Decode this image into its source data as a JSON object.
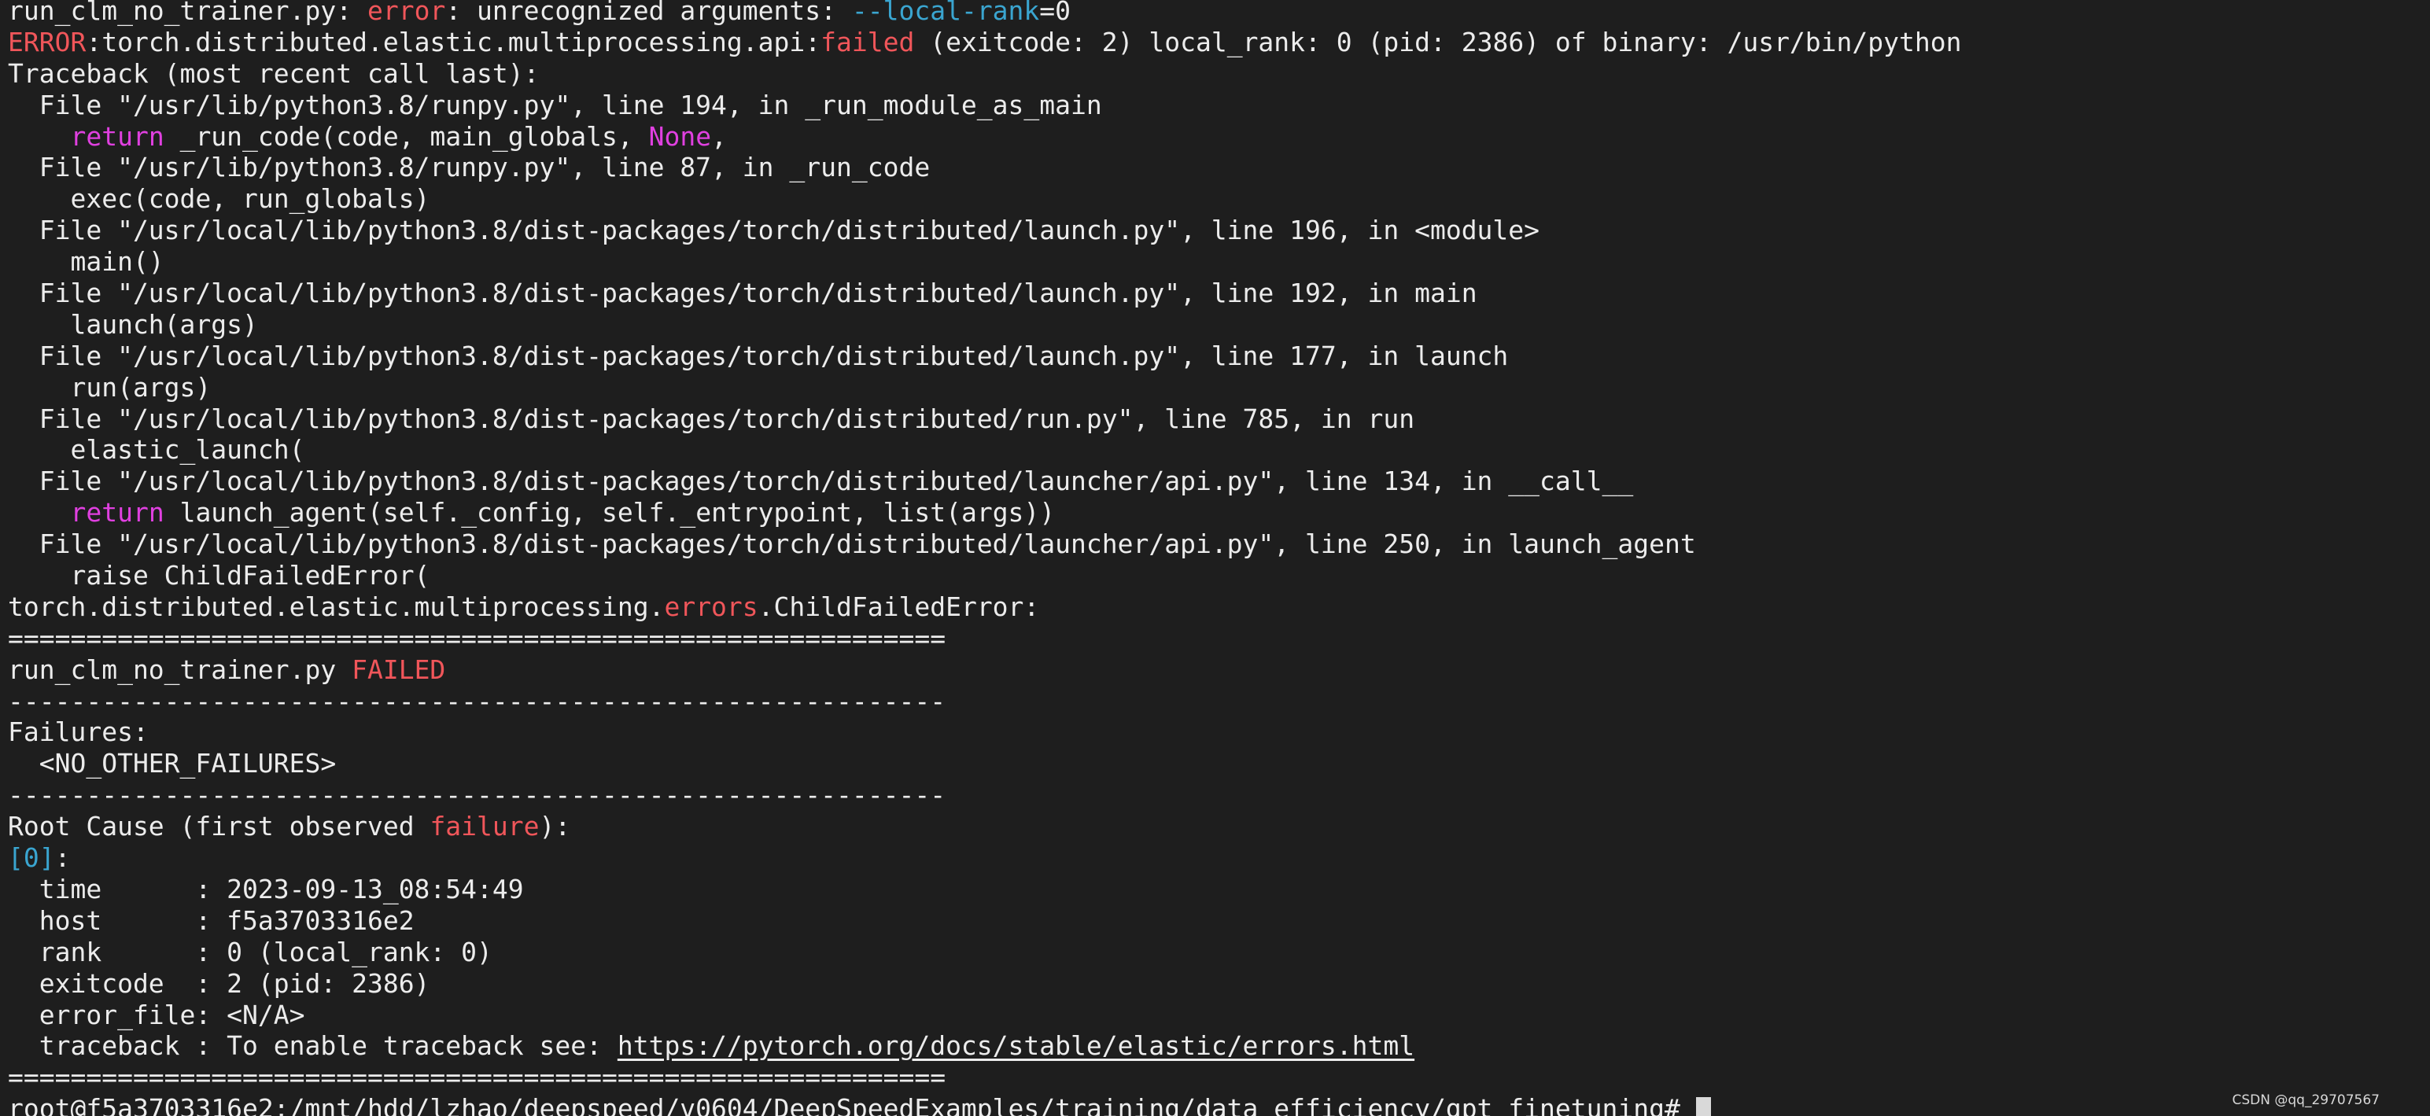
{
  "colors": {
    "background": "#1e1e1e",
    "text": "#ececec",
    "red": "#f0565a",
    "magenta": "#e040e0",
    "cyan": "#3aa5d0",
    "cursor": "#d9d9d9"
  },
  "terminal": {
    "lines": [
      [
        {
          "t": "run_clm_no_trainer.py: "
        },
        {
          "t": "error",
          "c": "red"
        },
        {
          "t": ": unrecognized arguments: "
        },
        {
          "t": "--local-rank",
          "c": "cyan"
        },
        {
          "t": "=0"
        }
      ],
      [
        {
          "t": "ERROR",
          "c": "red"
        },
        {
          "t": ":torch.distributed.elastic.multiprocessing.api:"
        },
        {
          "t": "failed",
          "c": "red"
        },
        {
          "t": " (exitcode: 2) local_rank: 0 (pid: 2386) of binary: /usr/bin/python"
        }
      ],
      [
        {
          "t": "Traceback (most recent call last):"
        }
      ],
      [
        {
          "t": "  File \"/usr/lib/python3.8/runpy.py\", line 194, in _run_module_as_main"
        }
      ],
      [
        {
          "t": "    "
        },
        {
          "t": "return",
          "c": "magenta"
        },
        {
          "t": " _run_code(code, main_globals, "
        },
        {
          "t": "None",
          "c": "magenta"
        },
        {
          "t": ","
        }
      ],
      [
        {
          "t": "  File \"/usr/lib/python3.8/runpy.py\", line 87, in _run_code"
        }
      ],
      [
        {
          "t": "    exec(code, run_globals)"
        }
      ],
      [
        {
          "t": "  File \"/usr/local/lib/python3.8/dist-packages/torch/distributed/launch.py\", line 196, in <module>"
        }
      ],
      [
        {
          "t": "    main()"
        }
      ],
      [
        {
          "t": "  File \"/usr/local/lib/python3.8/dist-packages/torch/distributed/launch.py\", line 192, in main"
        }
      ],
      [
        {
          "t": "    launch(args)"
        }
      ],
      [
        {
          "t": "  File \"/usr/local/lib/python3.8/dist-packages/torch/distributed/launch.py\", line 177, in launch"
        }
      ],
      [
        {
          "t": "    run(args)"
        }
      ],
      [
        {
          "t": "  File \"/usr/local/lib/python3.8/dist-packages/torch/distributed/run.py\", line 785, in run"
        }
      ],
      [
        {
          "t": "    elastic_launch("
        }
      ],
      [
        {
          "t": "  File \"/usr/local/lib/python3.8/dist-packages/torch/distributed/launcher/api.py\", line 134, in __call__"
        }
      ],
      [
        {
          "t": "    "
        },
        {
          "t": "return",
          "c": "magenta"
        },
        {
          "t": " launch_agent(self._config, self._entrypoint, list(args))"
        }
      ],
      [
        {
          "t": "  File \"/usr/local/lib/python3.8/dist-packages/torch/distributed/launcher/api.py\", line 250, in launch_agent"
        }
      ],
      [
        {
          "t": "    raise ChildFailedError("
        }
      ],
      [
        {
          "t": "torch.distributed.elastic.multiprocessing."
        },
        {
          "t": "errors",
          "c": "red"
        },
        {
          "t": ".ChildFailedError:"
        }
      ],
      [
        {
          "t": "============================================================"
        }
      ],
      [
        {
          "t": "run_clm_no_trainer.py "
        },
        {
          "t": "FAILED",
          "c": "red"
        }
      ],
      [
        {
          "t": "------------------------------------------------------------"
        }
      ],
      [
        {
          "t": "Failures:"
        }
      ],
      [
        {
          "t": "  <NO_OTHER_FAILURES>"
        }
      ],
      [
        {
          "t": "------------------------------------------------------------"
        }
      ],
      [
        {
          "t": "Root Cause (first observed "
        },
        {
          "t": "failure",
          "c": "red"
        },
        {
          "t": "):"
        }
      ],
      [
        {
          "t": "[0]",
          "c": "cyan"
        },
        {
          "t": ":"
        }
      ],
      [
        {
          "t": "  time      : 2023-09-13_08:54:49"
        }
      ],
      [
        {
          "t": "  host      : f5a3703316e2"
        }
      ],
      [
        {
          "t": "  rank      : 0 (local_rank: 0)"
        }
      ],
      [
        {
          "t": "  exitcode  : 2 (pid: 2386)"
        }
      ],
      [
        {
          "t": "  error_file: <N/A>"
        }
      ],
      [
        {
          "t": "  traceback : To enable traceback see: "
        },
        {
          "t": "https://pytorch.org/docs/stable/elastic/errors.html",
          "link": true
        }
      ],
      [
        {
          "t": "============================================================"
        }
      ],
      [
        {
          "t": "root@f5a3703316e2:/mnt/hdd/lzhao/deepspeed/v0604/DeepSpeedExamples/training/data_efficiency/gpt_finetuning# "
        },
        {
          "cursor": true
        }
      ]
    ]
  },
  "watermark": {
    "text": "CSDN @qq_29707567"
  }
}
